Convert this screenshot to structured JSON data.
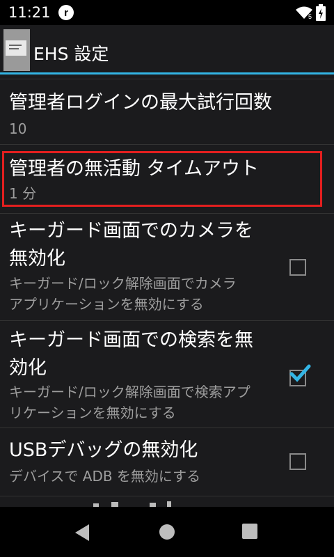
{
  "status_bar": {
    "time": "11:21",
    "app_icon_letter": "r"
  },
  "action_bar": {
    "title": "EHS 設定",
    "accent_color": "#33b5e5"
  },
  "preferences": [
    {
      "title": "管理者ログインの最大試行回数",
      "summary": "10"
    },
    {
      "title": "管理者の無活動 タイムアウト",
      "summary": "1 分"
    },
    {
      "title_line1": "キーガード画面でのカメラを",
      "title_line2": "無効化",
      "summary_line1": "キーガード/ロック解除画面でカメラ",
      "summary_line2": "アプリケーションを無効にする",
      "checked": false
    },
    {
      "title_line1": "キーガード画面での検索を無",
      "title_line2": "効化",
      "summary_line1": "キーガード/ロック解除画面で検索アプ",
      "summary_line2": "リケーションを無効にする",
      "checked": true
    },
    {
      "title": "USBデバッグの無効化",
      "summary": "デバイスで ADB を無効にする",
      "checked": false
    }
  ],
  "highlight_color": "#e41f1f",
  "nav_bar": {
    "buttons": [
      "back",
      "home",
      "recents"
    ]
  }
}
